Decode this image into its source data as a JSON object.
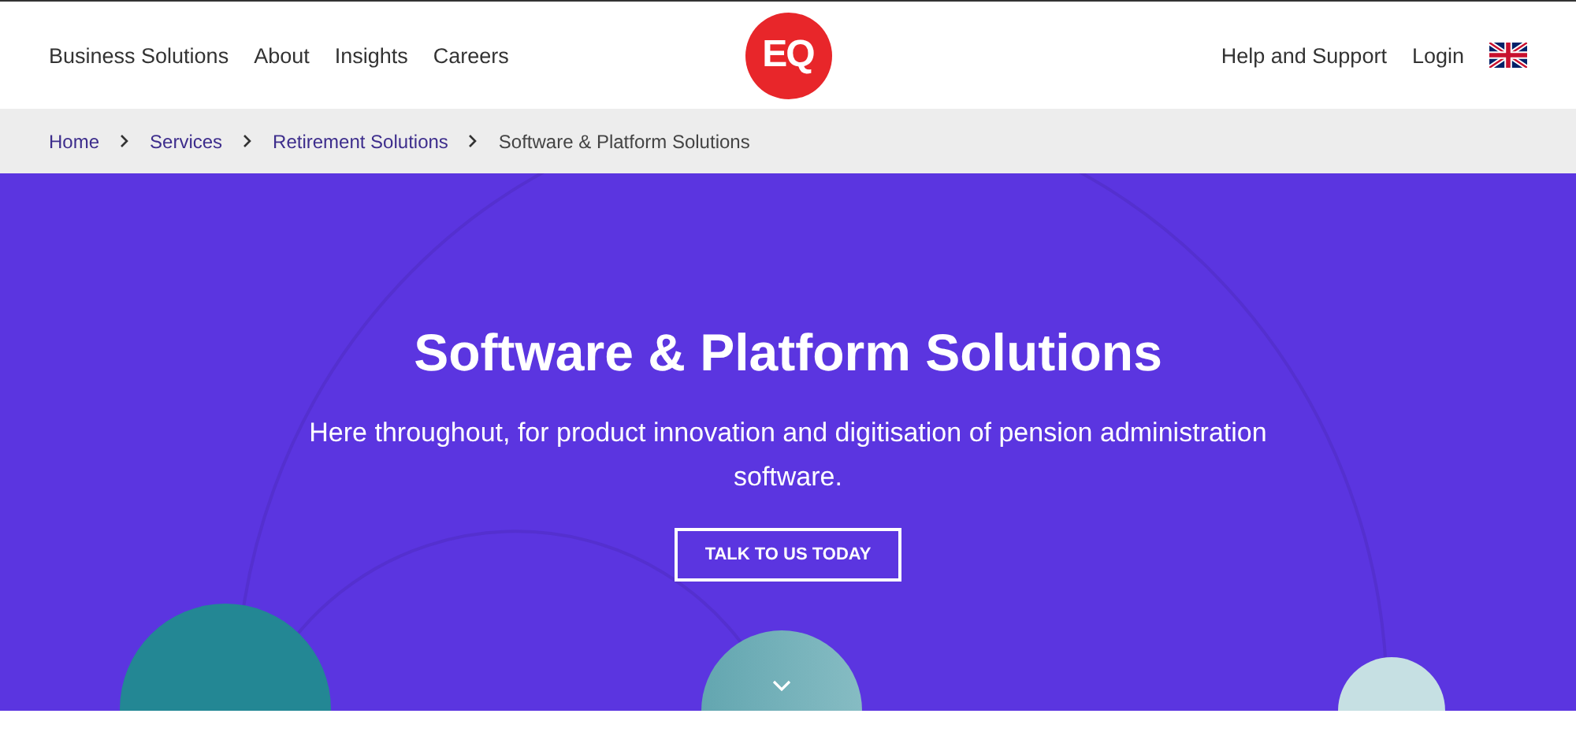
{
  "nav_left": [
    "Business Solutions",
    "About",
    "Insights",
    "Careers"
  ],
  "logo": "EQ",
  "nav_right": [
    "Help and Support",
    "Login"
  ],
  "breadcrumbs": [
    {
      "label": "Home",
      "current": false
    },
    {
      "label": "Services",
      "current": false
    },
    {
      "label": "Retirement Solutions",
      "current": false
    },
    {
      "label": "Software & Platform Solutions",
      "current": true
    }
  ],
  "hero": {
    "title": "Software & Platform Solutions",
    "subtitle": "Here throughout, for product innovation and digitisation of pension administration software.",
    "cta": "TALK TO US TODAY"
  }
}
